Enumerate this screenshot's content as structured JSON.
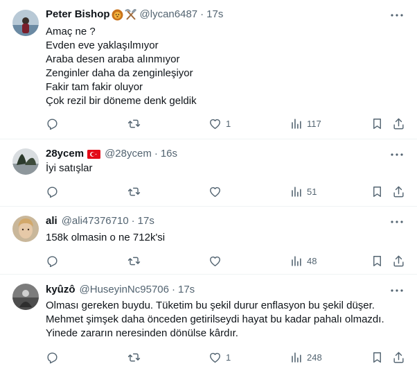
{
  "tweets": [
    {
      "name": "Peter Bishop",
      "name_badges": [
        "lion-emoji",
        "hammer-pick-emoji"
      ],
      "handle": "@lycan6487",
      "dot": "·",
      "time": "17s",
      "lines": [
        "Amaç ne ?",
        "Evden eve yaklaşılmıyor",
        "Araba desen araba alınmıyor",
        "Zenginler daha da zenginleşiyor",
        "Fakir tam fakir oluyor",
        "Çok rezil bir döneme denk geldik"
      ],
      "reply_count": "",
      "retweet_count": "",
      "like_count": "1",
      "view_count": "117"
    },
    {
      "name": "28ycem",
      "name_badges": [
        "turkey-flag"
      ],
      "handle": "@28ycem",
      "dot": "·",
      "time": "16s",
      "lines": [
        "İyi satışlar"
      ],
      "reply_count": "",
      "retweet_count": "",
      "like_count": "",
      "view_count": "51"
    },
    {
      "name": "ali",
      "name_badges": [],
      "handle": "@ali47376710",
      "dot": "·",
      "time": "17s",
      "lines": [
        "158k olmasin o ne 712k'si"
      ],
      "reply_count": "",
      "retweet_count": "",
      "like_count": "",
      "view_count": "48"
    },
    {
      "name": "kyûzô",
      "name_badges": [],
      "handle": "@HuseyinNc95706",
      "dot": "·",
      "time": "17s",
      "lines": [
        "Olması gereken buydu. Tüketim bu şekil durur enflasyon bu şekil düşer.",
        "Mehmet şimşek daha önceden getirilseydi hayat bu kadar pahalı olmazdı.",
        "Yinede zararın neresinden dönülse kârdır."
      ],
      "reply_count": "",
      "retweet_count": "",
      "like_count": "1",
      "view_count": "248"
    }
  ],
  "colors": {
    "text": "#0f1419",
    "secondary": "#536471",
    "divider": "#eff3f4"
  }
}
